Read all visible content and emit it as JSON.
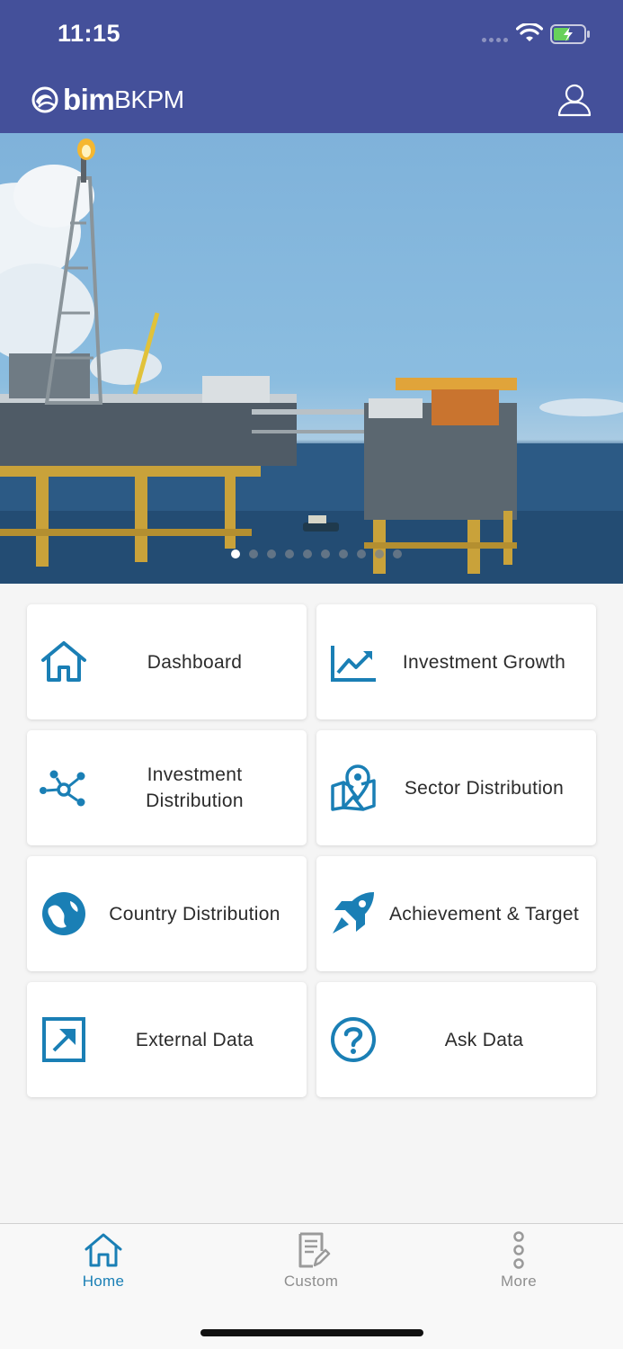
{
  "status_bar": {
    "time": "11:15"
  },
  "header": {
    "logo_bim": "bim",
    "logo_bkpm": "BKPM"
  },
  "carousel": {
    "page_count": 10,
    "active_index": 0
  },
  "menu": [
    {
      "label": "Dashboard",
      "icon": "home-icon"
    },
    {
      "label": "Investment Growth",
      "icon": "trending-up-icon"
    },
    {
      "label": "Investment\nDistribution",
      "icon": "network-icon"
    },
    {
      "label": "Sector Distribution",
      "icon": "map-pin-icon"
    },
    {
      "label": "Country Distribution",
      "icon": "globe-icon"
    },
    {
      "label": "Achievement & Target",
      "icon": "rocket-icon"
    },
    {
      "label": "External Data",
      "icon": "external-link-icon"
    },
    {
      "label": "Ask Data",
      "icon": "question-icon"
    }
  ],
  "tabs": [
    {
      "label": "Home",
      "icon": "home-icon",
      "active": true
    },
    {
      "label": "Custom",
      "icon": "document-edit-icon",
      "active": false
    },
    {
      "label": "More",
      "icon": "more-vertical-icon",
      "active": false
    }
  ],
  "colors": {
    "header": "#44509a",
    "accent": "#1a7fb5",
    "inactive": "#8e8e8e"
  }
}
